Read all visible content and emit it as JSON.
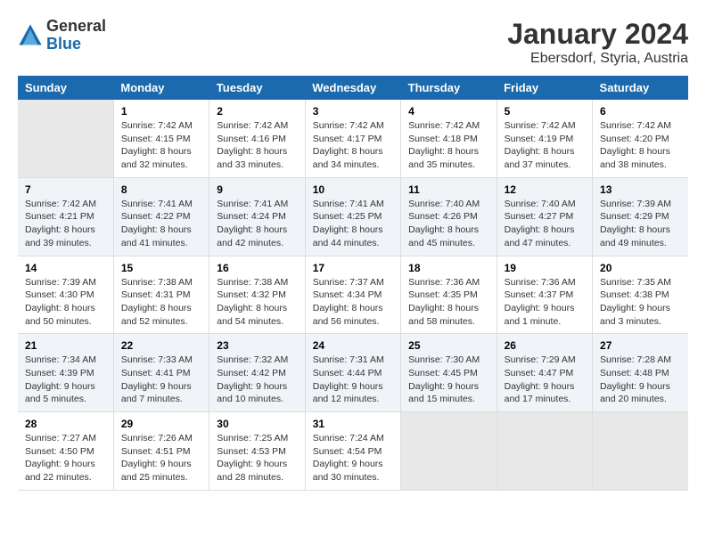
{
  "logo": {
    "general": "General",
    "blue": "Blue"
  },
  "title": "January 2024",
  "subtitle": "Ebersdorf, Styria, Austria",
  "weekdays": [
    "Sunday",
    "Monday",
    "Tuesday",
    "Wednesday",
    "Thursday",
    "Friday",
    "Saturday"
  ],
  "weeks": [
    [
      {
        "day": "",
        "sunrise": "",
        "sunset": "",
        "daylight": ""
      },
      {
        "day": "1",
        "sunrise": "Sunrise: 7:42 AM",
        "sunset": "Sunset: 4:15 PM",
        "daylight": "Daylight: 8 hours and 32 minutes."
      },
      {
        "day": "2",
        "sunrise": "Sunrise: 7:42 AM",
        "sunset": "Sunset: 4:16 PM",
        "daylight": "Daylight: 8 hours and 33 minutes."
      },
      {
        "day": "3",
        "sunrise": "Sunrise: 7:42 AM",
        "sunset": "Sunset: 4:17 PM",
        "daylight": "Daylight: 8 hours and 34 minutes."
      },
      {
        "day": "4",
        "sunrise": "Sunrise: 7:42 AM",
        "sunset": "Sunset: 4:18 PM",
        "daylight": "Daylight: 8 hours and 35 minutes."
      },
      {
        "day": "5",
        "sunrise": "Sunrise: 7:42 AM",
        "sunset": "Sunset: 4:19 PM",
        "daylight": "Daylight: 8 hours and 37 minutes."
      },
      {
        "day": "6",
        "sunrise": "Sunrise: 7:42 AM",
        "sunset": "Sunset: 4:20 PM",
        "daylight": "Daylight: 8 hours and 38 minutes."
      }
    ],
    [
      {
        "day": "7",
        "sunrise": "Sunrise: 7:42 AM",
        "sunset": "Sunset: 4:21 PM",
        "daylight": "Daylight: 8 hours and 39 minutes."
      },
      {
        "day": "8",
        "sunrise": "Sunrise: 7:41 AM",
        "sunset": "Sunset: 4:22 PM",
        "daylight": "Daylight: 8 hours and 41 minutes."
      },
      {
        "day": "9",
        "sunrise": "Sunrise: 7:41 AM",
        "sunset": "Sunset: 4:24 PM",
        "daylight": "Daylight: 8 hours and 42 minutes."
      },
      {
        "day": "10",
        "sunrise": "Sunrise: 7:41 AM",
        "sunset": "Sunset: 4:25 PM",
        "daylight": "Daylight: 8 hours and 44 minutes."
      },
      {
        "day": "11",
        "sunrise": "Sunrise: 7:40 AM",
        "sunset": "Sunset: 4:26 PM",
        "daylight": "Daylight: 8 hours and 45 minutes."
      },
      {
        "day": "12",
        "sunrise": "Sunrise: 7:40 AM",
        "sunset": "Sunset: 4:27 PM",
        "daylight": "Daylight: 8 hours and 47 minutes."
      },
      {
        "day": "13",
        "sunrise": "Sunrise: 7:39 AM",
        "sunset": "Sunset: 4:29 PM",
        "daylight": "Daylight: 8 hours and 49 minutes."
      }
    ],
    [
      {
        "day": "14",
        "sunrise": "Sunrise: 7:39 AM",
        "sunset": "Sunset: 4:30 PM",
        "daylight": "Daylight: 8 hours and 50 minutes."
      },
      {
        "day": "15",
        "sunrise": "Sunrise: 7:38 AM",
        "sunset": "Sunset: 4:31 PM",
        "daylight": "Daylight: 8 hours and 52 minutes."
      },
      {
        "day": "16",
        "sunrise": "Sunrise: 7:38 AM",
        "sunset": "Sunset: 4:32 PM",
        "daylight": "Daylight: 8 hours and 54 minutes."
      },
      {
        "day": "17",
        "sunrise": "Sunrise: 7:37 AM",
        "sunset": "Sunset: 4:34 PM",
        "daylight": "Daylight: 8 hours and 56 minutes."
      },
      {
        "day": "18",
        "sunrise": "Sunrise: 7:36 AM",
        "sunset": "Sunset: 4:35 PM",
        "daylight": "Daylight: 8 hours and 58 minutes."
      },
      {
        "day": "19",
        "sunrise": "Sunrise: 7:36 AM",
        "sunset": "Sunset: 4:37 PM",
        "daylight": "Daylight: 9 hours and 1 minute."
      },
      {
        "day": "20",
        "sunrise": "Sunrise: 7:35 AM",
        "sunset": "Sunset: 4:38 PM",
        "daylight": "Daylight: 9 hours and 3 minutes."
      }
    ],
    [
      {
        "day": "21",
        "sunrise": "Sunrise: 7:34 AM",
        "sunset": "Sunset: 4:39 PM",
        "daylight": "Daylight: 9 hours and 5 minutes."
      },
      {
        "day": "22",
        "sunrise": "Sunrise: 7:33 AM",
        "sunset": "Sunset: 4:41 PM",
        "daylight": "Daylight: 9 hours and 7 minutes."
      },
      {
        "day": "23",
        "sunrise": "Sunrise: 7:32 AM",
        "sunset": "Sunset: 4:42 PM",
        "daylight": "Daylight: 9 hours and 10 minutes."
      },
      {
        "day": "24",
        "sunrise": "Sunrise: 7:31 AM",
        "sunset": "Sunset: 4:44 PM",
        "daylight": "Daylight: 9 hours and 12 minutes."
      },
      {
        "day": "25",
        "sunrise": "Sunrise: 7:30 AM",
        "sunset": "Sunset: 4:45 PM",
        "daylight": "Daylight: 9 hours and 15 minutes."
      },
      {
        "day": "26",
        "sunrise": "Sunrise: 7:29 AM",
        "sunset": "Sunset: 4:47 PM",
        "daylight": "Daylight: 9 hours and 17 minutes."
      },
      {
        "day": "27",
        "sunrise": "Sunrise: 7:28 AM",
        "sunset": "Sunset: 4:48 PM",
        "daylight": "Daylight: 9 hours and 20 minutes."
      }
    ],
    [
      {
        "day": "28",
        "sunrise": "Sunrise: 7:27 AM",
        "sunset": "Sunset: 4:50 PM",
        "daylight": "Daylight: 9 hours and 22 minutes."
      },
      {
        "day": "29",
        "sunrise": "Sunrise: 7:26 AM",
        "sunset": "Sunset: 4:51 PM",
        "daylight": "Daylight: 9 hours and 25 minutes."
      },
      {
        "day": "30",
        "sunrise": "Sunrise: 7:25 AM",
        "sunset": "Sunset: 4:53 PM",
        "daylight": "Daylight: 9 hours and 28 minutes."
      },
      {
        "day": "31",
        "sunrise": "Sunrise: 7:24 AM",
        "sunset": "Sunset: 4:54 PM",
        "daylight": "Daylight: 9 hours and 30 minutes."
      },
      {
        "day": "",
        "sunrise": "",
        "sunset": "",
        "daylight": ""
      },
      {
        "day": "",
        "sunrise": "",
        "sunset": "",
        "daylight": ""
      },
      {
        "day": "",
        "sunrise": "",
        "sunset": "",
        "daylight": ""
      }
    ]
  ]
}
